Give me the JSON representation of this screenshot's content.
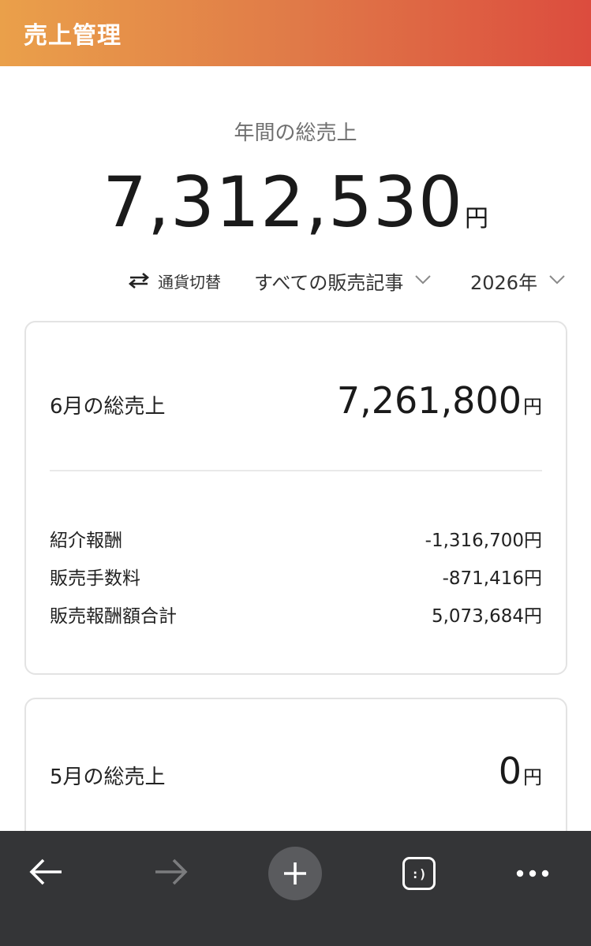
{
  "header": {
    "title": "売上管理"
  },
  "annual": {
    "label": "年間の総売上",
    "amount": "7,312,530",
    "unit": "円"
  },
  "filters": {
    "currency_toggle_label": "通貨切替",
    "article_filter": "すべての販売記事",
    "year_filter": "2026年"
  },
  "months": [
    {
      "label": "6月の総売上",
      "amount": "7,261,800",
      "unit": "円",
      "breakdown": [
        {
          "label": "紹介報酬",
          "value": "-1,316,700円"
        },
        {
          "label": "販売手数料",
          "value": "-871,416円"
        },
        {
          "label": "販売報酬額合計",
          "value": "5,073,684円"
        }
      ]
    },
    {
      "label": "5月の総売上",
      "amount": "0",
      "unit": "円"
    }
  ],
  "browser_bar": {
    "icons": [
      "back-arrow-icon",
      "forward-arrow-icon",
      "plus-icon",
      "tabs-icon",
      "more-icon"
    ],
    "tabs_glyph": ":)"
  },
  "colors": {
    "header_gradient_start": "#eaa04a",
    "header_gradient_end": "#dc4c3e",
    "bottom_bar": "#343537"
  }
}
